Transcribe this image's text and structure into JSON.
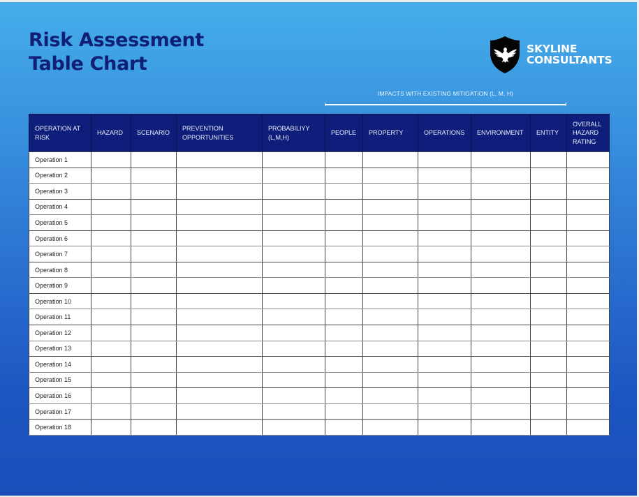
{
  "header": {
    "title_line1": "Risk Assessment",
    "title_line2": "Table Chart"
  },
  "logo": {
    "icon": "eagle-shield-icon",
    "line1": "SKYLINE",
    "line2": "CONSULTANTS"
  },
  "group_header": {
    "label": "IMPACTS WITH EXISTING MITIGATION (L, M, H)"
  },
  "colors": {
    "title": "#0f1f73",
    "table_header_bg": "#0f1e7a",
    "background_top": "#46aeea",
    "background_bottom": "#1a4fba"
  },
  "table": {
    "columns": [
      "OPERATION AT RISK",
      "HAZARD",
      "SCENARIO",
      "PREVENTION OPPORTUNITIES",
      "PROBABILIYY (L,M,H)",
      "PEOPLE",
      "PROPERTY",
      "OPERATIONS",
      "ENVIRONMENT",
      "ENTITY",
      "OVERALL HAZARD RATING"
    ],
    "rows": [
      [
        "Operation 1",
        "",
        "",
        "",
        "",
        "",
        "",
        "",
        "",
        "",
        ""
      ],
      [
        "Operation 2",
        "",
        "",
        "",
        "",
        "",
        "",
        "",
        "",
        "",
        ""
      ],
      [
        "Operation 3",
        "",
        "",
        "",
        "",
        "",
        "",
        "",
        "",
        "",
        ""
      ],
      [
        "Operation 4",
        "",
        "",
        "",
        "",
        "",
        "",
        "",
        "",
        "",
        ""
      ],
      [
        "Operation 5",
        "",
        "",
        "",
        "",
        "",
        "",
        "",
        "",
        "",
        ""
      ],
      [
        "Operation 6",
        "",
        "",
        "",
        "",
        "",
        "",
        "",
        "",
        "",
        ""
      ],
      [
        "Operation 7",
        "",
        "",
        "",
        "",
        "",
        "",
        "",
        "",
        "",
        ""
      ],
      [
        "Operation 8",
        "",
        "",
        "",
        "",
        "",
        "",
        "",
        "",
        "",
        ""
      ],
      [
        "Operation 9",
        "",
        "",
        "",
        "",
        "",
        "",
        "",
        "",
        "",
        ""
      ],
      [
        "Operation 10",
        "",
        "",
        "",
        "",
        "",
        "",
        "",
        "",
        "",
        ""
      ],
      [
        "Operation 11",
        "",
        "",
        "",
        "",
        "",
        "",
        "",
        "",
        "",
        ""
      ],
      [
        "Operation 12",
        "",
        "",
        "",
        "",
        "",
        "",
        "",
        "",
        "",
        ""
      ],
      [
        "Operation 13",
        "",
        "",
        "",
        "",
        "",
        "",
        "",
        "",
        "",
        ""
      ],
      [
        "Operation 14",
        "",
        "",
        "",
        "",
        "",
        "",
        "",
        "",
        "",
        ""
      ],
      [
        "Operation 15",
        "",
        "",
        "",
        "",
        "",
        "",
        "",
        "",
        "",
        ""
      ],
      [
        "Operation 16",
        "",
        "",
        "",
        "",
        "",
        "",
        "",
        "",
        "",
        ""
      ],
      [
        "Operation 17",
        "",
        "",
        "",
        "",
        "",
        "",
        "",
        "",
        "",
        ""
      ],
      [
        "Operation 18",
        "",
        "",
        "",
        "",
        "",
        "",
        "",
        "",
        "",
        ""
      ]
    ]
  }
}
